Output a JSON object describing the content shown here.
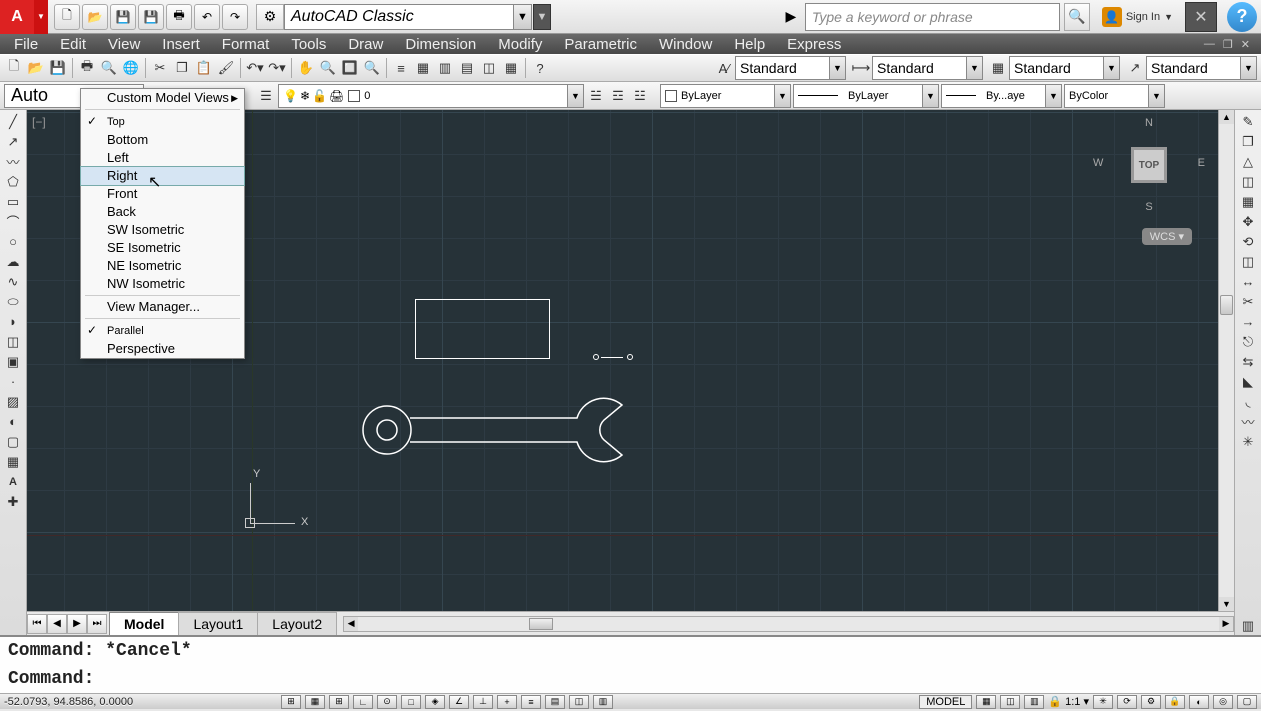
{
  "title": {
    "workspace": "AutoCAD Classic"
  },
  "search": {
    "placeholder": "Type a keyword or phrase"
  },
  "signin": {
    "label": "Sign In"
  },
  "menubar": {
    "items": [
      "File",
      "Edit",
      "View",
      "Insert",
      "Format",
      "Tools",
      "Draw",
      "Dimension",
      "Modify",
      "Parametric",
      "Window",
      "Help",
      "Express"
    ]
  },
  "styles": {
    "text": "Standard",
    "dim": "Standard",
    "table": "Standard",
    "mleader": "Standard"
  },
  "toolbar2": {
    "appname": "Auto",
    "layer_value": "0",
    "color": "ByLayer",
    "linetype": "ByLayer",
    "lineweight": "By...aye",
    "plotstyle": "ByColor"
  },
  "tabs": {
    "model": "Model",
    "l1": "Layout1",
    "l2": "Layout2"
  },
  "viewcube": {
    "top": "TOP",
    "n": "N",
    "s": "S",
    "e": "E",
    "w": "W",
    "wcs": "WCS"
  },
  "ucs": {
    "x": "X",
    "y": "Y"
  },
  "cmd": {
    "line1": "Command: *Cancel*",
    "line2": "Command:"
  },
  "status": {
    "coords": "-52.0793, 94.8586, 0.0000",
    "space": "MODEL",
    "scale": "1:1"
  },
  "context": {
    "custom": "Custom Model Views",
    "top": "Top",
    "bottom": "Bottom",
    "left": "Left",
    "right": "Right",
    "front": "Front",
    "back": "Back",
    "sw": "SW Isometric",
    "se": "SE Isometric",
    "ne": "NE Isometric",
    "nw": "NW Isometric",
    "vm": "View Manager...",
    "parallel": "Parallel",
    "perspective": "Perspective"
  }
}
